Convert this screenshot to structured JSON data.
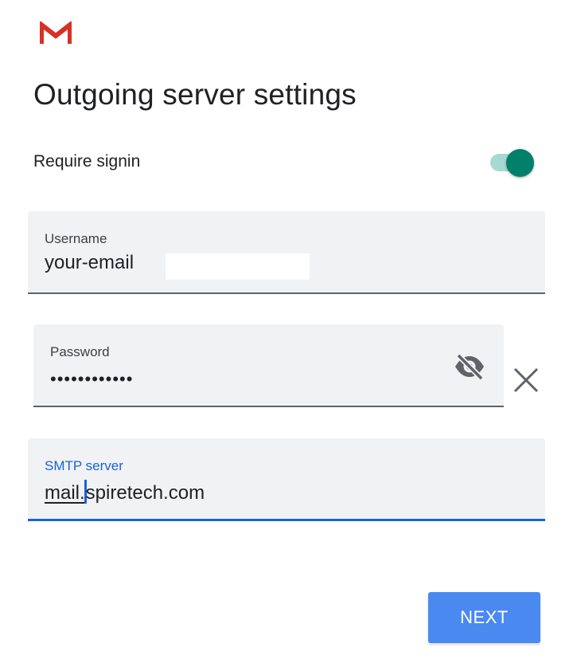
{
  "app": {
    "logo_icon": "gmail-logo-icon"
  },
  "header": {
    "title": "Outgoing server settings"
  },
  "require_signin": {
    "label": "Require signin",
    "enabled": true,
    "color_on": "#00806b"
  },
  "username": {
    "label": "Username",
    "value": "your-email"
  },
  "password": {
    "label": "Password",
    "value": "••••••••••••",
    "visibility_icon": "eye-off-icon",
    "clear_icon": "close-icon"
  },
  "smtp": {
    "label": "SMTP server",
    "value_typed": "mail.",
    "value_rest": "spiretech.com"
  },
  "actions": {
    "next_label": "NEXT"
  },
  "colors": {
    "accent": "#1a63d4",
    "button": "#4a89f0",
    "field_bg": "#f1f2f3"
  }
}
